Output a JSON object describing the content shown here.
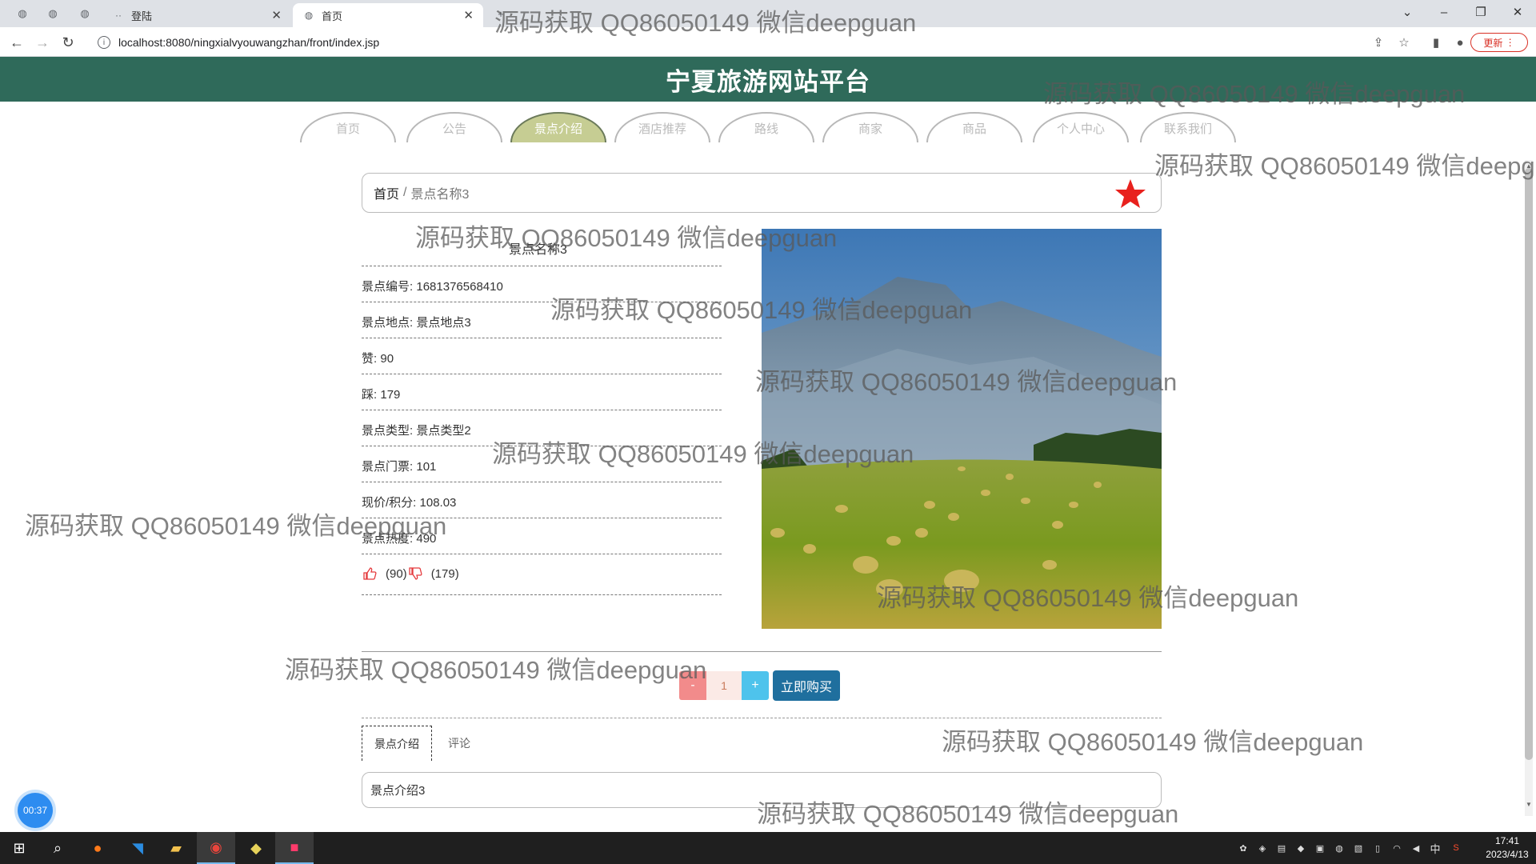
{
  "browser": {
    "tabs": [
      {
        "title": "登陆",
        "active": false
      },
      {
        "title": "首页",
        "active": true
      }
    ],
    "url": "localhost:8080/ningxialvyouwangzhan/front/index.jsp",
    "update_label": "更新"
  },
  "site": {
    "title": "宁夏旅游网站平台",
    "nav": [
      "首页",
      "公告",
      "景点介绍",
      "酒店推荐",
      "路线",
      "商家",
      "商品",
      "个人中心",
      "联系我们"
    ],
    "active_nav": "景点介绍"
  },
  "breadcrumb": {
    "home": "首页",
    "separator": "/",
    "current": "景点名称3"
  },
  "detail": {
    "name": "景点名称3",
    "fields": [
      {
        "label": "景点编号",
        "value": "1681376568410"
      },
      {
        "label": "景点地点",
        "value": "景点地点3"
      },
      {
        "label": "赞",
        "value": "90"
      },
      {
        "label": "踩",
        "value": "179"
      },
      {
        "label": "景点类型",
        "value": "景点类型2"
      },
      {
        "label": "景点门票",
        "value": "101"
      },
      {
        "label": "现价/积分",
        "value": "108.03"
      },
      {
        "label": "景点热度",
        "value": "490"
      }
    ],
    "thumbs_up_count": "(90)",
    "thumbs_down_count": "(179)",
    "image_caption": "http://sc.pcfoltaae.com.cn/1001017/"
  },
  "purchase": {
    "minus_label": "-",
    "quantity": "1",
    "plus_label": "+",
    "buy_label": "立即购买"
  },
  "detail_tabs": {
    "tabs": [
      "景点介绍",
      "评论"
    ],
    "active": "景点介绍",
    "content": "景点介绍3"
  },
  "timer": "00:37",
  "taskbar": {
    "time": "17:41",
    "date": "2023/4/13",
    "ime": "中"
  },
  "watermark_text": "源码获取 QQ86050149 微信deepguan",
  "colors": {
    "header_bg": "#2f6a5a",
    "nav_active_bg": "#c6cd93",
    "star": "#e8211d",
    "buy_button": "#1f6f9e",
    "minus_button": "#f28b8b",
    "plus_button": "#4ec3ec"
  }
}
